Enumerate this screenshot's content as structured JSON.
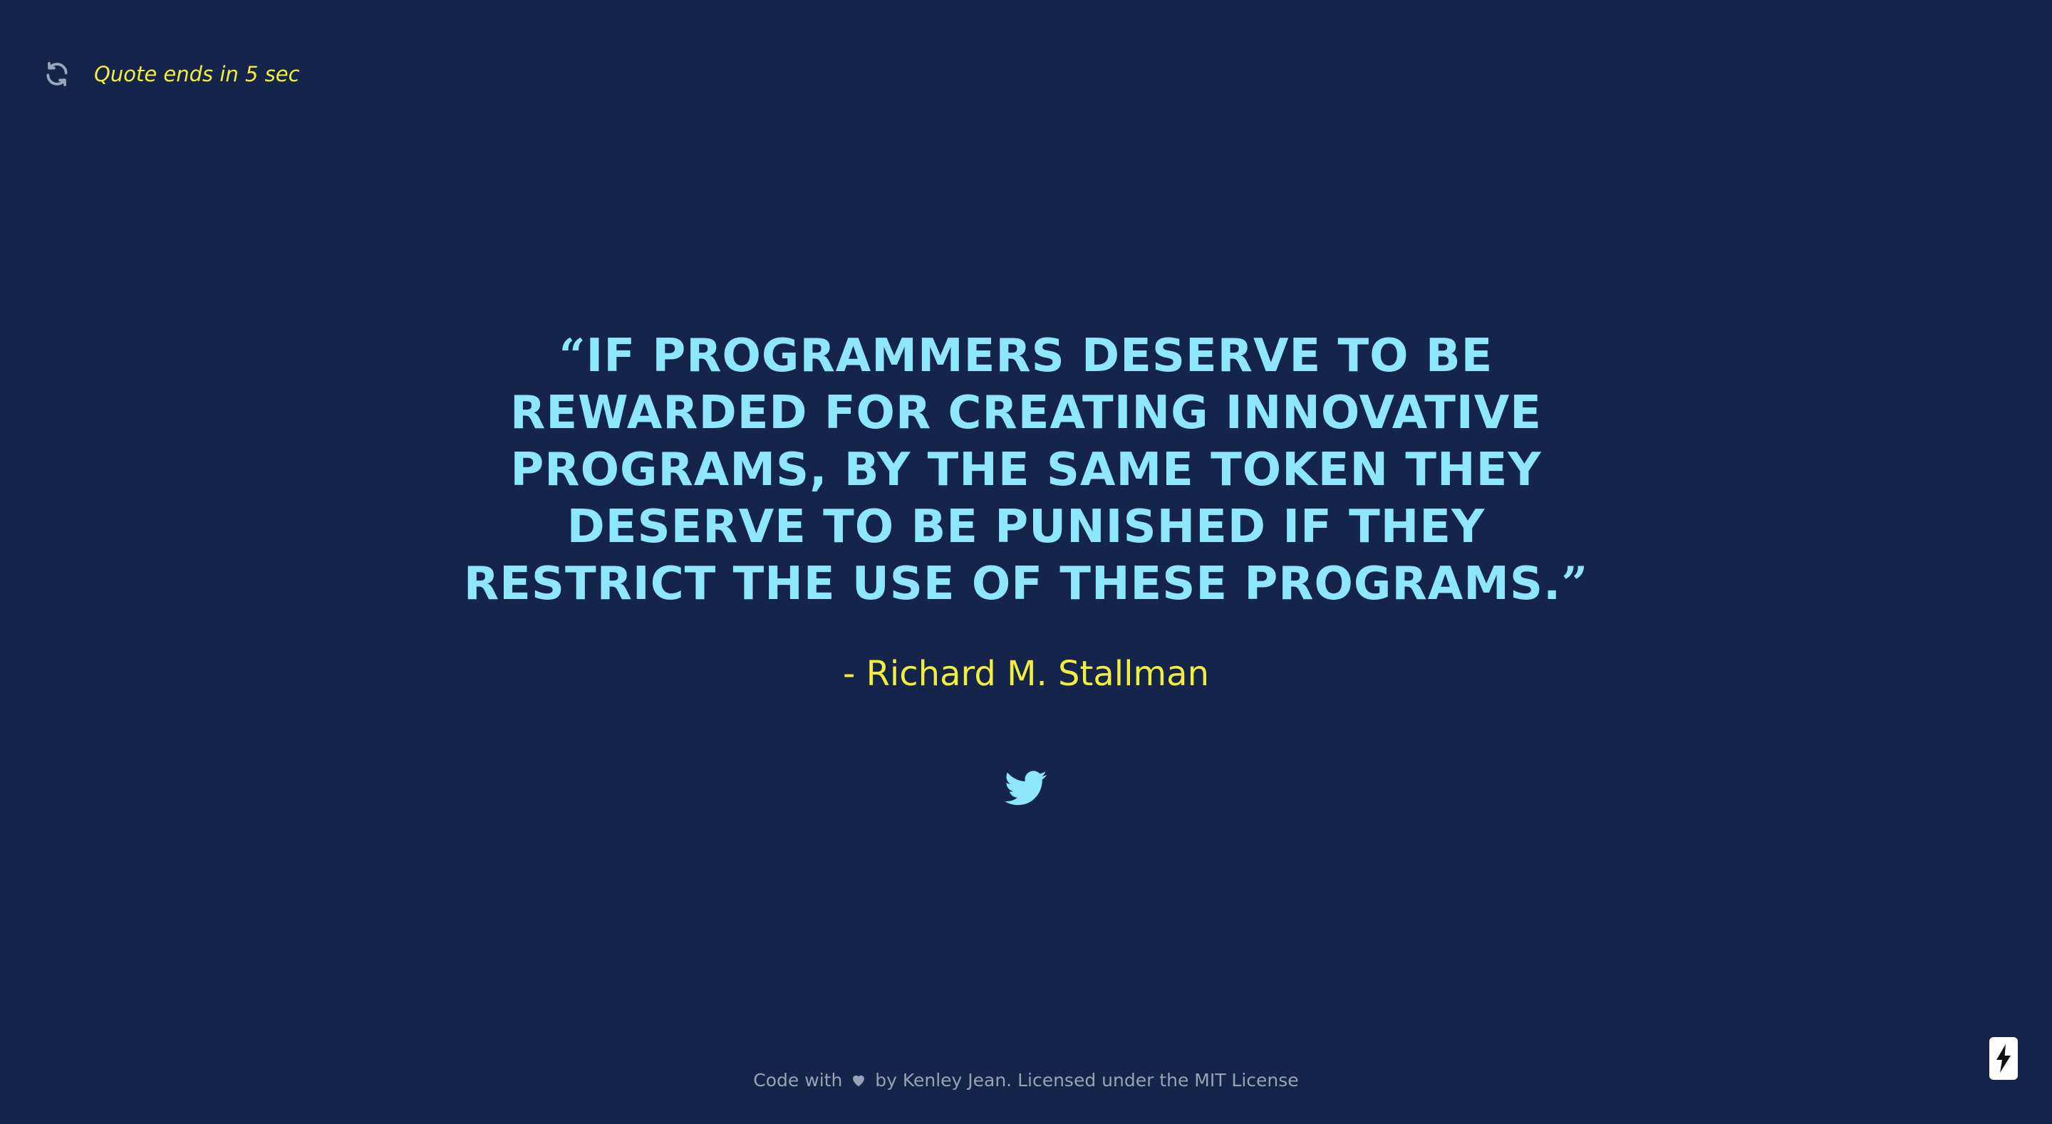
{
  "status": {
    "countdown_text": "Quote ends in 5 sec"
  },
  "quote": {
    "open_mark": "“",
    "text": "If programmers deserve to be rewarded for creating innovative programs, by the same token they deserve to be punished if they restrict the use of these programs.",
    "close_mark": "”",
    "author": "- Richard M. Stallman"
  },
  "footer": {
    "text_before": "Code with",
    "text_after": "by Kenley Jean. Licensed under the MIT License"
  },
  "icons": {
    "refresh": "refresh-icon",
    "share": "twitter-icon",
    "heart": "heart-icon",
    "badge": "lightning-bolt-icon"
  },
  "colors": {
    "background": "#15244a",
    "quote": "#8ee6fb",
    "accent": "#f3ee3e",
    "footer": "#98a2b6"
  }
}
